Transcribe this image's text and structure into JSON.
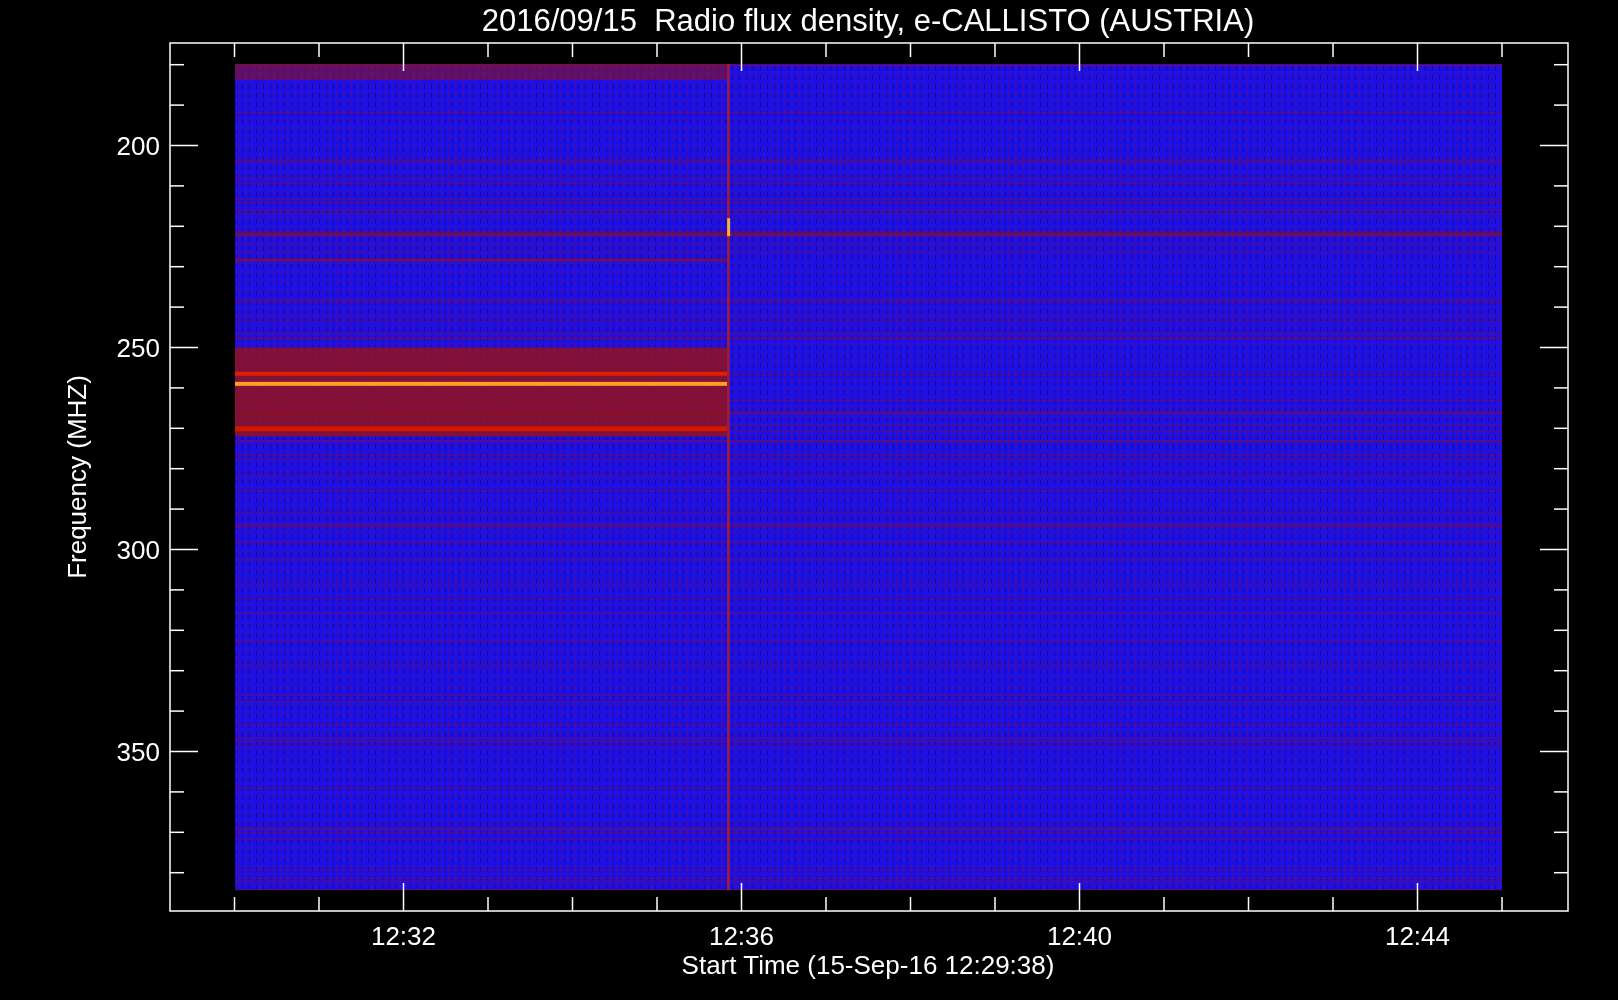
{
  "title": "2016/09/15  Radio flux density, e-CALLISTO (AUSTRIA)",
  "plot": {
    "kind": "spectrogram",
    "ylabel": "Frequency (MHZ)",
    "xlabel": "Start Time (15-Sep-16 12:29:38)",
    "yticks": [
      "200",
      "250",
      "300",
      "350"
    ],
    "xticks": [
      "12:32",
      "12:36",
      "12:40",
      "12:44"
    ]
  }
}
